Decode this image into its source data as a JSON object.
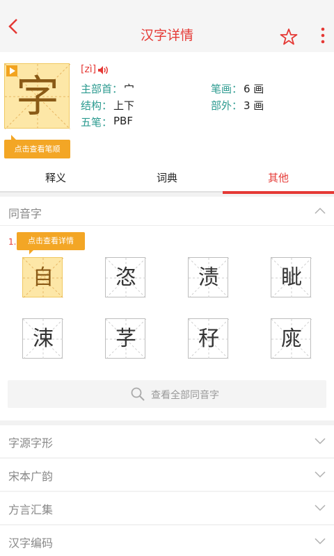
{
  "header": {
    "title": "汉字详情"
  },
  "character": {
    "char": "字",
    "pinyin": "[zì]",
    "stroke_order_button": "点击查看笔顺",
    "fields": {
      "radical_label": "主部首：",
      "radical_value": "宀",
      "strokes_label": "笔画：",
      "strokes_value": "6 画",
      "structure_label": "结构：",
      "structure_value": "上下",
      "outside_label": "部外：",
      "outside_value": "3 画",
      "wubi_label": "五笔：",
      "wubi_value": "PBF"
    }
  },
  "tabs": [
    {
      "label": "释义",
      "active": false
    },
    {
      "label": "词典",
      "active": false
    },
    {
      "label": "其他",
      "active": true
    }
  ],
  "homophones": {
    "title": "同音字",
    "index": "1.",
    "tip": "点击查看详情",
    "chars": [
      "自",
      "恣",
      "渍",
      "眦",
      "涑",
      "芓",
      "秄",
      "庣"
    ],
    "view_all": "查看全部同音字"
  },
  "sections": [
    {
      "title": "字源字形"
    },
    {
      "title": "宋本广韵"
    },
    {
      "title": "方言汇集"
    },
    {
      "title": "汉字编码"
    }
  ],
  "colors": {
    "accent": "#e53935",
    "highlight": "#fde7a7",
    "label": "#2b9a8f",
    "tip": "#f3a625"
  }
}
